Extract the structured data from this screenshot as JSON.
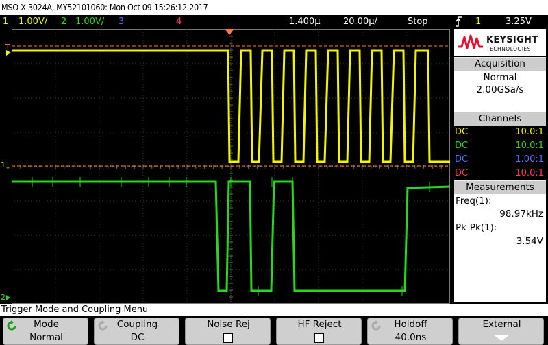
{
  "title": "MSO-X 3024A, MY52101060: Mon Oct 09 15:26:12 2017",
  "status": {
    "ch1_num": "1",
    "ch1_scale": "1.00V/",
    "ch2_num": "2",
    "ch2_scale": "1.00V/",
    "ch3_num": "3",
    "ch4_num": "4",
    "time_delay": "1.400µ",
    "time_scale": "20.00µ/",
    "run_state": "Stop",
    "trig_ch": "1",
    "trig_level": "3.25V"
  },
  "logo": {
    "brand": "KEYSIGHT",
    "sub": "TECHNOLOGIES"
  },
  "acquisition": {
    "title": "Acquisition",
    "mode": "Normal",
    "rate": "2.00GSa/s"
  },
  "channels": {
    "title": "Channels",
    "rows": [
      {
        "coupling": "DC",
        "probe": "10.0:1",
        "color": "#f4f400"
      },
      {
        "coupling": "DC",
        "probe": "10.0:1",
        "color": "#27d81f"
      },
      {
        "coupling": "DC",
        "probe": "1.00:1",
        "color": "#5a6cf0"
      },
      {
        "coupling": "DC",
        "probe": "10.0:1",
        "color": "#ff3a5e"
      }
    ]
  },
  "measurements": {
    "title": "Measurements",
    "items": [
      {
        "label": "Freq(1):",
        "value": "98.97kHz"
      },
      {
        "label": "Pk-Pk(1):",
        "value": "3.54V"
      }
    ]
  },
  "markers": {
    "trig_t": "T",
    "ch1": "1",
    "ch2": "2"
  },
  "menu_title": "Trigger Mode and Coupling Menu",
  "softkeys": [
    {
      "top": "Mode",
      "bottom": "Normal"
    },
    {
      "top": "Coupling",
      "bottom": "DC"
    },
    {
      "top": "Noise Rej",
      "bottom": ""
    },
    {
      "top": "HF Reject",
      "bottom": ""
    },
    {
      "top": "Holdoff",
      "bottom": "40.0ns"
    },
    {
      "top": "External",
      "bottom": ""
    }
  ],
  "colors": {
    "ch1": "#f4f400",
    "ch2": "#27d81f",
    "ch3": "#5a6cf0",
    "ch4": "#ff3a5e",
    "trigger": "#ff7a3c"
  }
}
